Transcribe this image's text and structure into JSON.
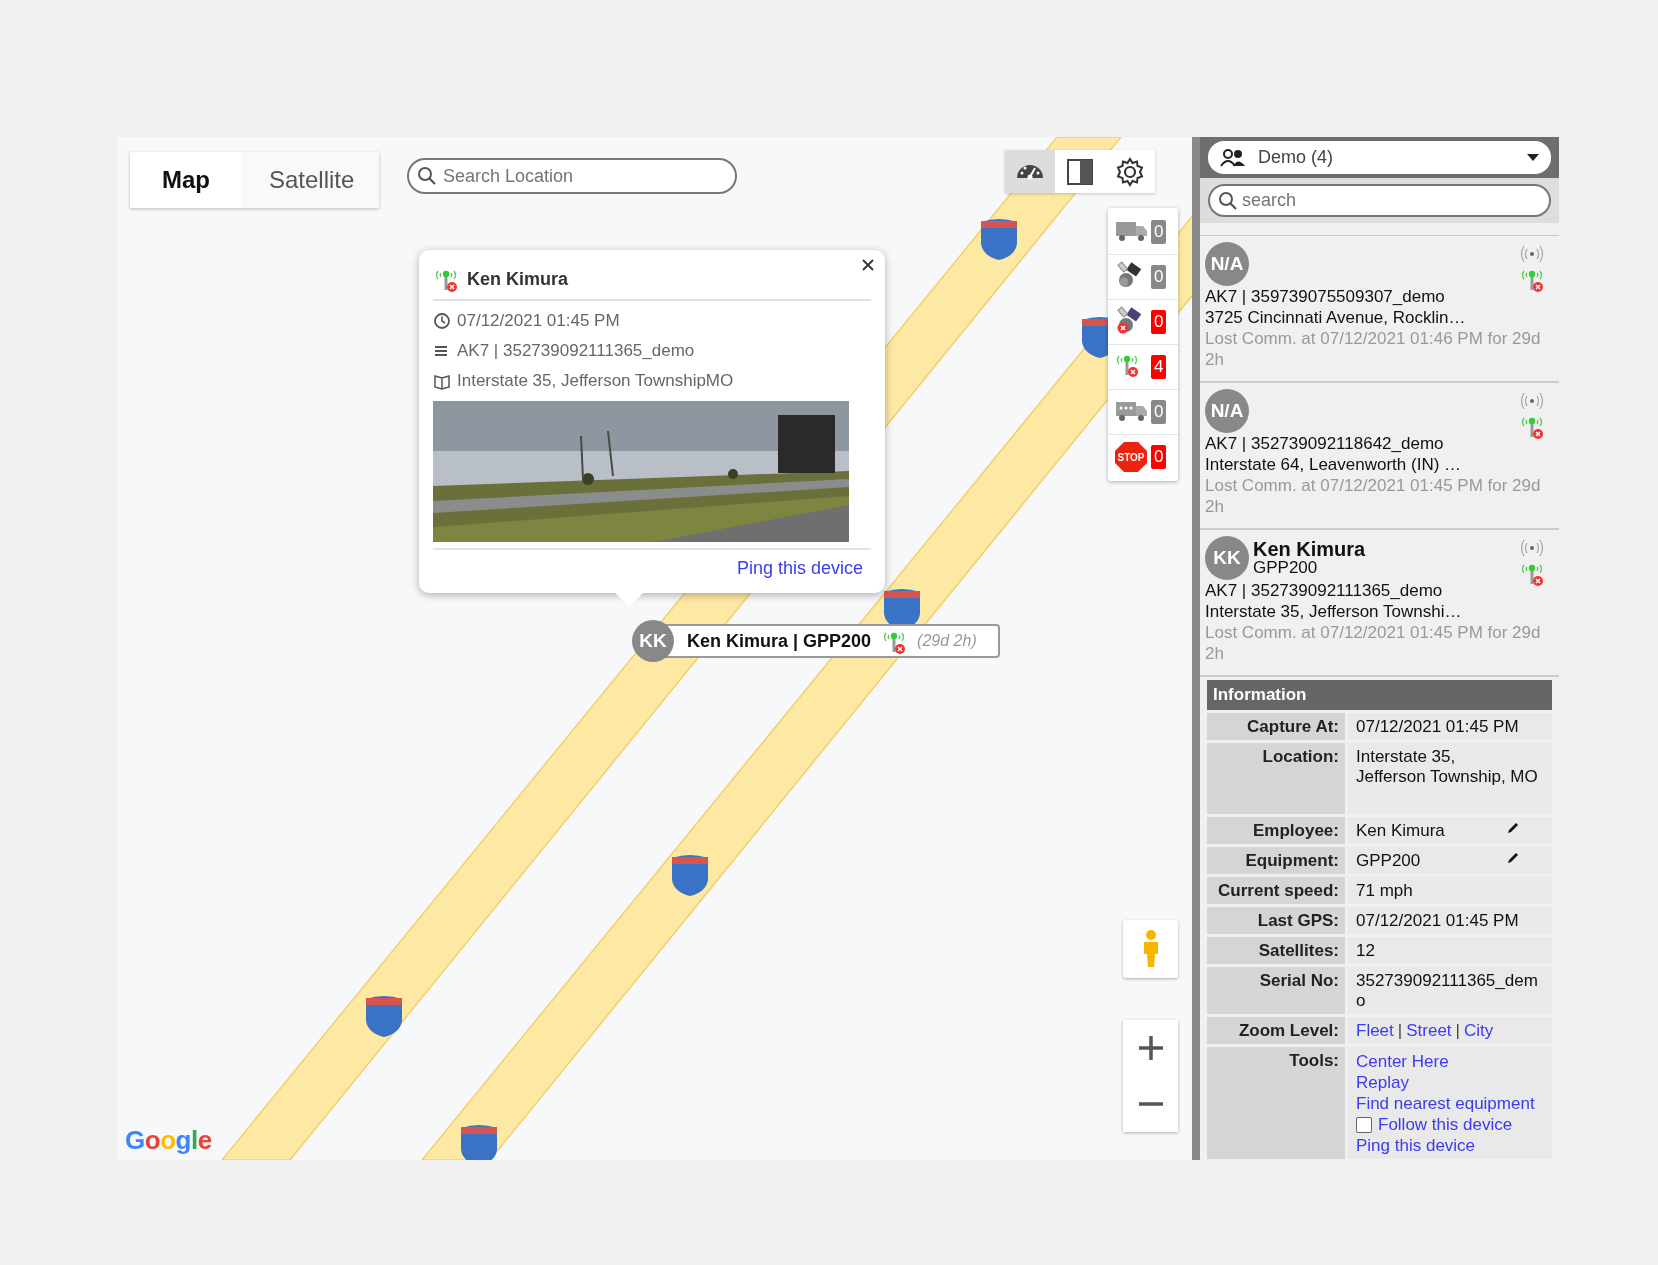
{
  "map": {
    "type_tabs": [
      {
        "label": "Map",
        "selected": true
      },
      {
        "label": "Satellite",
        "selected": false
      }
    ],
    "search": {
      "placeholder": "Search Location"
    },
    "toolbar": [
      {
        "kind": "dashboard",
        "selected": true
      },
      {
        "kind": "panel",
        "selected": false
      },
      {
        "kind": "settings",
        "selected": false
      }
    ],
    "counters": [
      {
        "kind": "truck",
        "count": "0",
        "alert": false
      },
      {
        "kind": "satellite-question",
        "count": "0",
        "alert": false
      },
      {
        "kind": "satellite-error",
        "count": "0",
        "alert": true
      },
      {
        "kind": "signal-lost",
        "count": "4",
        "alert": true
      },
      {
        "kind": "bus",
        "count": "0",
        "alert": false
      },
      {
        "kind": "stop",
        "icon_text": "STOP",
        "count": "0",
        "alert": true
      }
    ],
    "popup": {
      "title": "Ken Kimura",
      "time": "07/12/2021 01:45 PM",
      "device": "AK7 | 352739092111365_demo",
      "address": "Interstate 35, Jefferson TownshipMO",
      "link": "Ping this device"
    },
    "marker": {
      "initials": "KK",
      "label": "Ken Kimura | GPP200",
      "duration": "(29d 2h)"
    },
    "logo": "Google"
  },
  "panel": {
    "group": "Demo (4)",
    "search": {
      "placeholder": "search"
    },
    "devices": [
      {
        "initials": "N/A",
        "device": "AK7 | 359739075509307_demo",
        "address": "3725 Cincinnati Avenue, Rocklin…",
        "status": "Lost Comm. at 07/12/2021 01:46 PM for 29d 2h"
      },
      {
        "initials": "N/A",
        "device": "AK7 | 352739092118642_demo",
        "address": "Interstate 64, Leavenworth (IN) …",
        "status": "Lost Comm. at 07/12/2021 01:45 PM for 29d 2h"
      },
      {
        "initials": "KK",
        "name": "Ken Kimura",
        "equipment": "GPP200",
        "device": "AK7 | 352739092111365_demo",
        "address": "Interstate 35, Jefferson Townshi…",
        "status": "Lost Comm. at 07/12/2021 01:45 PM for 29d 2h"
      }
    ],
    "info": {
      "title": "Information",
      "rows": [
        {
          "kind": "text",
          "label": "Capture At:",
          "value": "07/12/2021 01:45 PM"
        },
        {
          "kind": "text",
          "label": "Location:",
          "value": "Interstate 35,\nJefferson Township, MO",
          "tall": true
        },
        {
          "kind": "text",
          "label": "Employee:",
          "value": "Ken Kimura",
          "editable": true
        },
        {
          "kind": "text",
          "label": "Equipment:",
          "value": "GPP200",
          "editable": true
        },
        {
          "kind": "text",
          "label": "Current speed:",
          "value": "71 mph"
        },
        {
          "kind": "text",
          "label": "Last GPS:",
          "value": "07/12/2021 01:45 PM"
        },
        {
          "kind": "text",
          "label": "Satellites:",
          "value": "12"
        },
        {
          "kind": "code",
          "label": "Serial No:",
          "value": "352739092111365_demo"
        },
        {
          "kind": "links",
          "label": "Zoom Level:",
          "separator": "|",
          "links": [
            "Fleet",
            "Street",
            "City"
          ]
        },
        {
          "kind": "tools",
          "label": "Tools:",
          "items": [
            {
              "kind": "link",
              "text": "Center Here"
            },
            {
              "kind": "link",
              "text": "Replay"
            },
            {
              "kind": "link",
              "text": "Find nearest equipment"
            },
            {
              "kind": "checkbox",
              "text": "Follow this device",
              "checked": false
            },
            {
              "kind": "link",
              "text": "Ping this device"
            }
          ]
        }
      ]
    }
  }
}
